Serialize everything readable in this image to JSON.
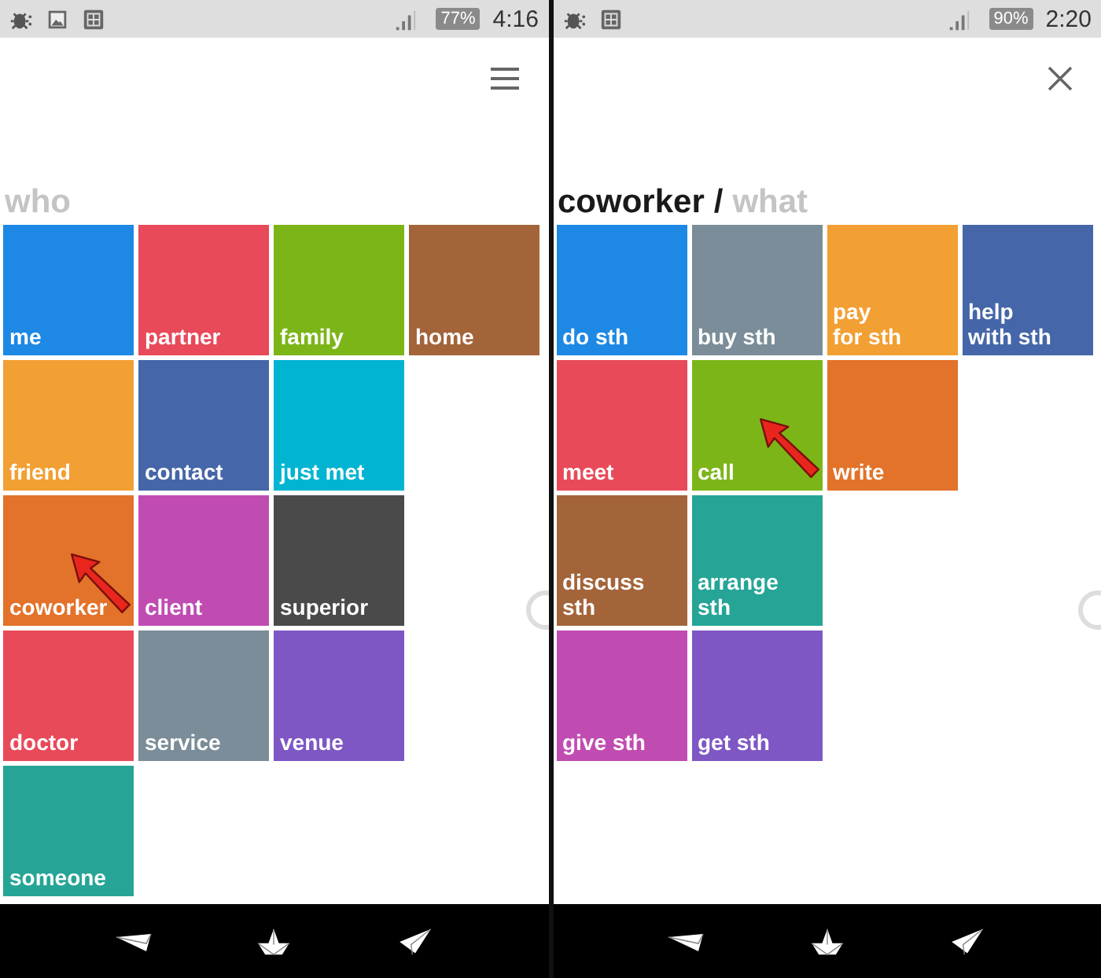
{
  "screens": [
    {
      "status_bar": {
        "notification_icons": [
          {
            "kind": "debug"
          },
          {
            "kind": "image"
          },
          {
            "kind": "grid"
          }
        ],
        "battery": "77%",
        "time": "4:16"
      },
      "menu_open": false,
      "title": [
        {
          "text": "who",
          "kind": "prompt"
        }
      ],
      "rows": [
        [
          {
            "label": "me",
            "color": "#1e88e5"
          },
          {
            "label": "partner",
            "color": "#e84a5a"
          },
          {
            "label": "family",
            "color": "#7cb518"
          },
          {
            "label": "home",
            "color": "#a3643a"
          }
        ],
        [
          {
            "label": "friend",
            "color": "#f29f33"
          },
          {
            "label": "contact",
            "color": "#4566a8"
          },
          {
            "label": "just met",
            "color": "#00b4d2"
          }
        ],
        [
          {
            "label": "coworker",
            "color": "#e3722a",
            "pointed": true
          },
          {
            "label": "client",
            "color": "#c04cb2"
          },
          {
            "label": "superior",
            "color": "#4a4a4a"
          }
        ],
        [
          {
            "label": "doctor",
            "color": "#e84a5a"
          },
          {
            "label": "service",
            "color": "#7a8d99"
          },
          {
            "label": "venue",
            "color": "#7e57c4"
          }
        ],
        [
          {
            "label": "someone",
            "color": "#26a597"
          }
        ]
      ]
    },
    {
      "status_bar": {
        "notification_icons": [
          {
            "kind": "debug"
          },
          {
            "kind": "grid"
          }
        ],
        "battery": "90%",
        "time": "2:20"
      },
      "menu_open": true,
      "title": [
        {
          "text": "coworker",
          "kind": "chosen"
        },
        {
          "text": "/",
          "kind": "separator"
        },
        {
          "text": "what",
          "kind": "prompt"
        }
      ],
      "rows": [
        [
          {
            "label": "do sth",
            "color": "#1e88e5"
          },
          {
            "label": "buy sth",
            "color": "#7a8d99"
          },
          {
            "label": "pay\nfor sth",
            "color": "#f29f33"
          },
          {
            "label": "help\nwith sth",
            "color": "#4566a8"
          }
        ],
        [
          {
            "label": "meet",
            "color": "#e84a5a"
          },
          {
            "label": "call",
            "color": "#7cb518",
            "pointed": true
          },
          {
            "label": "write",
            "color": "#e3722a"
          }
        ],
        [
          {
            "label": "discuss\nsth",
            "color": "#a3643a"
          },
          {
            "label": "arrange\nsth",
            "color": "#26a597"
          }
        ],
        [
          {
            "label": "give sth",
            "color": "#c04cb2"
          },
          {
            "label": "get sth",
            "color": "#7e57c4"
          }
        ]
      ]
    }
  ]
}
